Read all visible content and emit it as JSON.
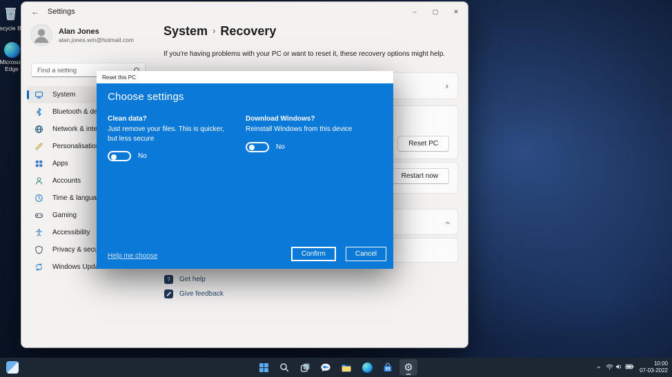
{
  "colors": {
    "accent": "#0067c0",
    "dialog_blue": "#0b79d7"
  },
  "desktop": {
    "icons": [
      {
        "label": "Recycle Bin"
      },
      {
        "label": "Microsoft Edge"
      }
    ]
  },
  "window": {
    "titlebar": {
      "back": "←",
      "title": "Settings",
      "minimize": "–",
      "maximize": "▢",
      "close": "✕"
    },
    "profile": {
      "name": "Alan Jones",
      "email": "alan.jones.wm@hotmail.com"
    },
    "search": {
      "placeholder": "Find a setting"
    },
    "nav": {
      "items": [
        {
          "label": "System",
          "icon": "system",
          "selected": true
        },
        {
          "label": "Bluetooth & devices",
          "icon": "bluetooth"
        },
        {
          "label": "Network & internet",
          "icon": "network"
        },
        {
          "label": "Personalisation",
          "icon": "personalisation"
        },
        {
          "label": "Apps",
          "icon": "apps"
        },
        {
          "label": "Accounts",
          "icon": "accounts"
        },
        {
          "label": "Time & language",
          "icon": "time"
        },
        {
          "label": "Gaming",
          "icon": "gaming"
        },
        {
          "label": "Accessibility",
          "icon": "accessibility"
        },
        {
          "label": "Privacy & security",
          "icon": "privacy"
        },
        {
          "label": "Windows Update",
          "icon": "update"
        }
      ]
    },
    "main": {
      "breadcrumb": {
        "root": "System",
        "separator": "›",
        "current": "Recovery"
      },
      "description": "If you're having problems with your PC or want to reset it, these recovery options might help.",
      "reset_button": "Reset PC",
      "restart_button": "Restart now",
      "links": [
        {
          "label": "Get help"
        },
        {
          "label": "Give feedback"
        }
      ]
    }
  },
  "dialog": {
    "title": "Reset this PC",
    "heading": "Choose settings",
    "options": [
      {
        "title": "Clean data?",
        "description": "Just remove your files. This is quicker, but less secure",
        "toggle_label": "No",
        "toggle_state": "off"
      },
      {
        "title": "Download Windows?",
        "description": "Reinstall Windows from this device",
        "toggle_label": "No",
        "toggle_state": "off"
      }
    ],
    "help_link": "Help me choose",
    "confirm_button": "Confirm",
    "cancel_button": "Cancel"
  },
  "taskbar": {
    "apps": [
      {
        "name": "start"
      },
      {
        "name": "search"
      },
      {
        "name": "task-view"
      },
      {
        "name": "chat"
      },
      {
        "name": "file-explorer"
      },
      {
        "name": "edge"
      },
      {
        "name": "store"
      },
      {
        "name": "settings",
        "active": true
      }
    ],
    "tray": {
      "time": "10:00",
      "date": "07-03-2022"
    }
  }
}
